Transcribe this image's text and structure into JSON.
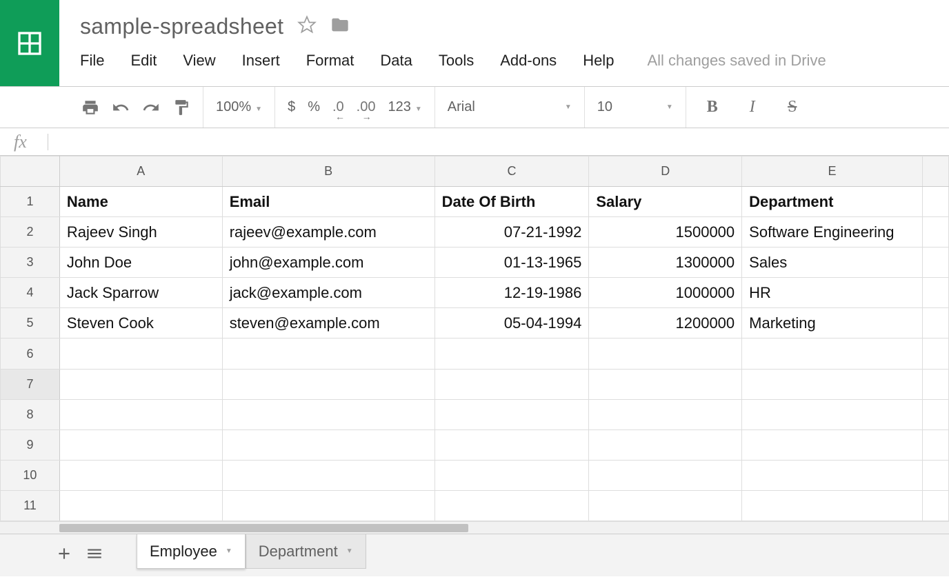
{
  "doc": {
    "title": "sample-spreadsheet",
    "save_status": "All changes saved in Drive"
  },
  "menus": {
    "file": "File",
    "edit": "Edit",
    "view": "View",
    "insert": "Insert",
    "format": "Format",
    "data": "Data",
    "tools": "Tools",
    "addons": "Add-ons",
    "help": "Help"
  },
  "toolbar": {
    "zoom": "100%",
    "currency": "$",
    "percent": "%",
    "dec_dec": ".0",
    "inc_dec": ".00",
    "format123": "123",
    "font": "Arial",
    "font_size": "10",
    "bold": "B",
    "italic": "I",
    "strike": "S"
  },
  "fx": {
    "label": "fx"
  },
  "columns": {
    "A": "A",
    "B": "B",
    "C": "C",
    "D": "D",
    "E": "E"
  },
  "row_labels": {
    "r1": "1",
    "r2": "2",
    "r3": "3",
    "r4": "4",
    "r5": "5",
    "r6": "6",
    "r7": "7",
    "r8": "8",
    "r9": "9",
    "r10": "10",
    "r11": "11"
  },
  "headers": {
    "name": "Name",
    "email": "Email",
    "dob": "Date Of Birth",
    "salary": "Salary",
    "dept": "Department"
  },
  "rows": {
    "r2": {
      "name": "Rajeev Singh",
      "email": "rajeev@example.com",
      "dob": "07-21-1992",
      "salary": "1500000",
      "dept": "Software Engineering"
    },
    "r3": {
      "name": "John Doe",
      "email": "john@example.com",
      "dob": "01-13-1965",
      "salary": "1300000",
      "dept": "Sales"
    },
    "r4": {
      "name": "Jack Sparrow",
      "email": "jack@example.com",
      "dob": "12-19-1986",
      "salary": "1000000",
      "dept": "HR"
    },
    "r5": {
      "name": "Steven Cook",
      "email": "steven@example.com",
      "dob": "05-04-1994",
      "salary": "1200000",
      "dept": "Marketing"
    }
  },
  "tabs": {
    "t1": "Employee",
    "t2": "Department"
  }
}
